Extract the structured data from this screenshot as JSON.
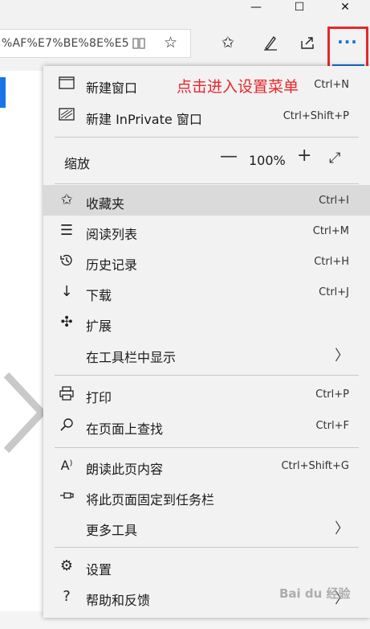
{
  "window": {
    "minimize_glyph": "—",
    "maximize_glyph": "☐",
    "close_glyph": "✕"
  },
  "toolbar": {
    "address_text": "%AF%E7%BE%8E%E5",
    "reading_view_icon": "book-icon",
    "favorite_icon": "star-icon",
    "favorites_hub_icon": "star-list-icon",
    "notes_icon": "pen-icon",
    "share_icon": "share-icon",
    "more_label": "···"
  },
  "menu": {
    "new_window": "新建窗口",
    "new_inprivate": "新建 InPrivate 窗口",
    "new_window_shortcut": "Ctrl+N",
    "new_inprivate_shortcut": "Ctrl+Shift+P",
    "zoom_label": "缩放",
    "zoom_value": "100%",
    "items": [
      {
        "label": "收藏夹",
        "shortcut": "Ctrl+I"
      },
      {
        "label": "阅读列表",
        "shortcut": "Ctrl+M"
      },
      {
        "label": "历史记录",
        "shortcut": "Ctrl+H"
      },
      {
        "label": "下载",
        "shortcut": "Ctrl+J"
      },
      {
        "label": "扩展",
        "shortcut": ""
      },
      {
        "label": "在工具栏中显示",
        "shortcut": ""
      },
      {
        "label": "打印",
        "shortcut": "Ctrl+P"
      },
      {
        "label": "在页面上查找",
        "shortcut": "Ctrl+F"
      },
      {
        "label": "朗读此页内容",
        "shortcut": "Ctrl+Shift+G"
      },
      {
        "label": "将此页面固定到任务栏",
        "shortcut": ""
      },
      {
        "label": "更多工具",
        "shortcut": ""
      },
      {
        "label": "设置",
        "shortcut": ""
      },
      {
        "label": "帮助和反馈",
        "shortcut": ""
      }
    ]
  },
  "annotation": "点击进入设置菜单",
  "watermark": "Bai du 经验",
  "colors": {
    "annotation": "#e8262b",
    "accent": "#1a6fd6",
    "highlight": "#dadada"
  }
}
